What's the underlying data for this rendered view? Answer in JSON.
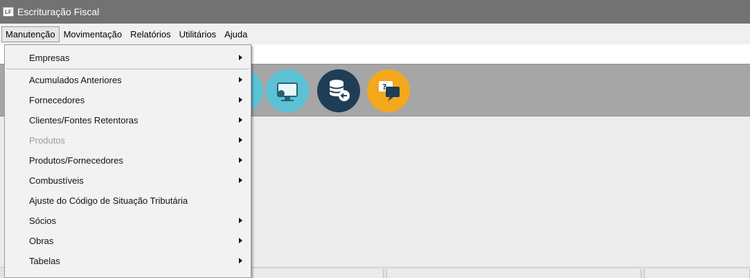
{
  "window": {
    "title": "Escrituração Fiscal",
    "logo_text": "LF"
  },
  "menubar": {
    "items": [
      {
        "label": "Manutenção"
      },
      {
        "label": "Movimentação"
      },
      {
        "label": "Relatórios"
      },
      {
        "label": "Utilitários"
      },
      {
        "label": "Ajuda"
      }
    ]
  },
  "dropdown": {
    "items": [
      {
        "label": "Empresas",
        "submenu": true,
        "disabled": false
      },
      {
        "label": "Acumulados Anteriores",
        "submenu": true,
        "disabled": false
      },
      {
        "label": "Fornecedores",
        "submenu": true,
        "disabled": false
      },
      {
        "label": "Clientes/Fontes Retentoras",
        "submenu": true,
        "disabled": false
      },
      {
        "label": "Produtos",
        "submenu": true,
        "disabled": true
      },
      {
        "label": "Produtos/Fornecedores",
        "submenu": true,
        "disabled": false
      },
      {
        "label": "Combustíveis",
        "submenu": true,
        "disabled": false
      },
      {
        "label": "Ajuste do Código de Situação Tributária",
        "submenu": false,
        "disabled": false
      },
      {
        "label": "Sócios",
        "submenu": true,
        "disabled": false
      },
      {
        "label": "Obras",
        "submenu": true,
        "disabled": false
      },
      {
        "label": "Tabelas",
        "submenu": true,
        "disabled": false
      }
    ]
  },
  "toolbar": {
    "buttons": [
      {
        "name": "monitor-icon",
        "color": "#5bc2d6"
      },
      {
        "name": "database-icon",
        "color": "#1f3d55"
      },
      {
        "name": "help-chat-icon",
        "color": "#f3a81d"
      }
    ]
  },
  "colors": {
    "titlebar": "#727272",
    "toolbar_bg": "#a6a6a6",
    "disabled_text": "#9b9b9b"
  }
}
